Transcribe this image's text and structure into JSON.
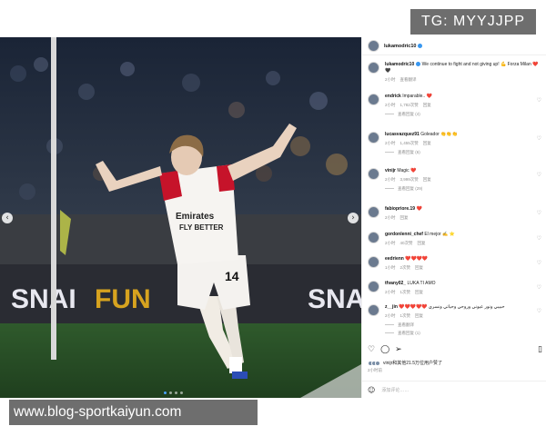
{
  "watermark_top": "TG: MYYJJPP",
  "watermark_bottom": "www.blog-sportkaiyun.com",
  "photo": {
    "jersey_text": "Emirates FLY BETTER",
    "jersey_number": "14",
    "board_text_left": "SNAI",
    "board_text_mid": "FUN",
    "board_text_right": "SNA"
  },
  "post": {
    "username": "lukamodric10",
    "caption_user": "lukamodric10",
    "caption_text": "We continue to fight and not giving up! 💪 Forza Milan ❤️🖤",
    "caption_meta_time": "2小时",
    "caption_meta_translate": "查看翻译"
  },
  "comments": [
    {
      "user": "endrick",
      "text": "Imparable.. ❤️",
      "time": "2小时",
      "likes": "1,782次赞",
      "reply": "回复",
      "replies": "查看回复 (4)"
    },
    {
      "user": "lucasvazquez91",
      "text": "Goleador 👏👏👏",
      "time": "2小时",
      "likes": "1,455次赞",
      "reply": "回复",
      "replies": "查看回复 (6)"
    },
    {
      "user": "vinijr",
      "text": "Magic ❤️",
      "time": "2小时",
      "likes": "3,999次赞",
      "reply": "回复",
      "replies": "查看回复 (29)"
    },
    {
      "user": "fabiopriore.19",
      "text": "❤️",
      "time": "2小时",
      "likes": "",
      "reply": "回复",
      "replies": ""
    },
    {
      "user": "gordonlenni_chef",
      "text": "El mejor ✍️ ⭐",
      "time": "2小时",
      "likes": "40次赞",
      "reply": "回复",
      "replies": ""
    },
    {
      "user": "eedrienn",
      "text": "❤️❤️❤️❤️",
      "time": "1小时",
      "likes": "2次赞",
      "reply": "回复",
      "replies": ""
    },
    {
      "user": "tfvany02_",
      "text": "LUKA TI AMO",
      "time": "2小时",
      "likes": "1次赞",
      "reply": "回复",
      "replies": ""
    },
    {
      "user": "z__jin",
      "text": "❤️❤️❤️❤️❤️ حبيبي ونور عيوني وروحي وحياتي ونسري",
      "time": "2小时",
      "likes": "1次赞",
      "reply": "回复",
      "replies": "查看翻译"
    }
  ],
  "last_replies": "查看回复 (1)",
  "liked_by": "vinijr和其他21.5万位用户赞了",
  "post_time": "2小时前",
  "add_comment_placeholder": "添加评论……",
  "icons": {
    "heart": "heart-icon",
    "comment": "comment-icon",
    "share": "share-icon",
    "bookmark": "bookmark-icon",
    "emoji": "emoji-icon"
  },
  "colors": {
    "verified": "#3897f0",
    "watermark_bg": "#6e6e6e",
    "pitch": "#2f5a2c",
    "meta_gray": "#8e8e8e"
  }
}
